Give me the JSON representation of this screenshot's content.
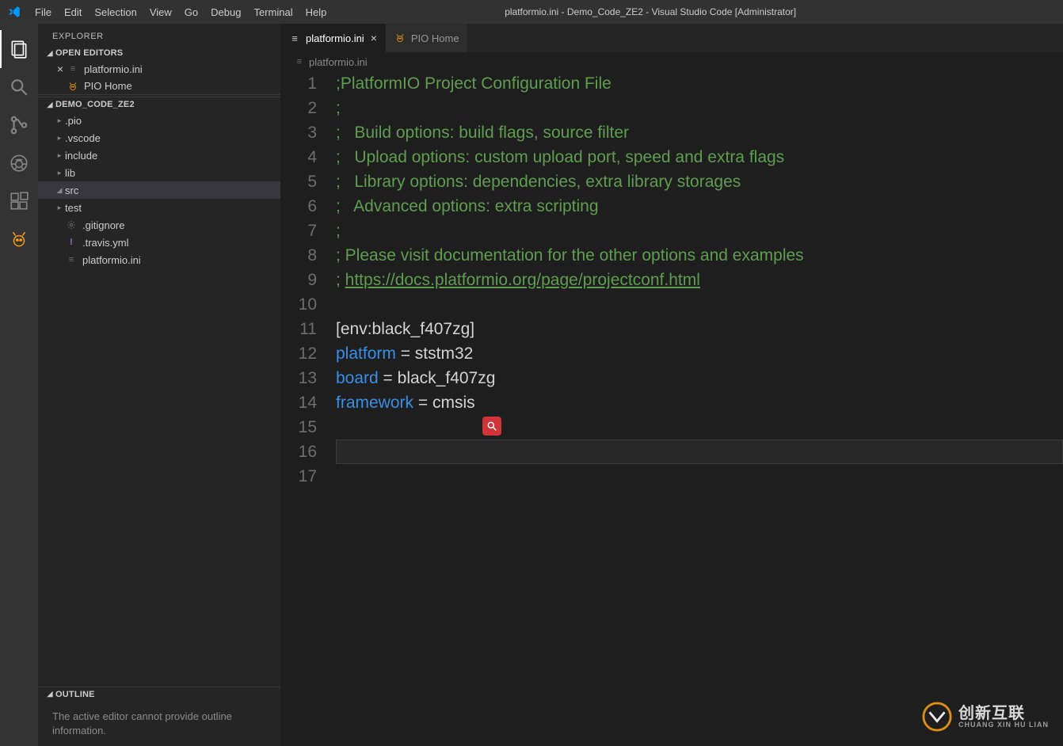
{
  "window": {
    "title": "platformio.ini - Demo_Code_ZE2 - Visual Studio Code [Administrator]"
  },
  "menubar": [
    "File",
    "Edit",
    "Selection",
    "View",
    "Go",
    "Debug",
    "Terminal",
    "Help"
  ],
  "sidebar": {
    "header": "EXPLORER",
    "open_editors_label": "OPEN EDITORS",
    "open_editors": [
      {
        "name": "platformio.ini",
        "icon": "settings"
      },
      {
        "name": "PIO Home",
        "icon": "pio"
      }
    ],
    "workspace_label": "DEMO_CODE_ZE2",
    "tree": [
      {
        "kind": "folder",
        "name": ".pio"
      },
      {
        "kind": "folder",
        "name": ".vscode"
      },
      {
        "kind": "folder",
        "name": "include"
      },
      {
        "kind": "folder",
        "name": "lib"
      },
      {
        "kind": "folder",
        "name": "src",
        "expanded": true,
        "selected": true
      },
      {
        "kind": "folder",
        "name": "test"
      },
      {
        "kind": "file",
        "name": ".gitignore",
        "icon": "gear"
      },
      {
        "kind": "file",
        "name": ".travis.yml",
        "icon": "bang"
      },
      {
        "kind": "file",
        "name": "platformio.ini",
        "icon": "settings"
      }
    ],
    "outline_label": "OUTLINE",
    "outline_msg": "The active editor cannot provide outline information."
  },
  "tabs": [
    {
      "name": "platformio.ini",
      "icon": "settings",
      "active": true,
      "closeable": true
    },
    {
      "name": "PIO Home",
      "icon": "pio",
      "active": false,
      "closeable": false
    }
  ],
  "breadcrumb": {
    "label": "platformio.ini",
    "icon": "settings"
  },
  "editor": {
    "lines": [
      {
        "n": 1,
        "t": "comment",
        "text": ";PlatformIO Project Configuration File"
      },
      {
        "n": 2,
        "t": "comment",
        "text": ";"
      },
      {
        "n": 3,
        "t": "comment",
        "text": ";   Build options: build flags, source filter"
      },
      {
        "n": 4,
        "t": "comment",
        "text": ";   Upload options: custom upload port, speed and extra flags"
      },
      {
        "n": 5,
        "t": "comment",
        "text": ";   Library options: dependencies, extra library storages"
      },
      {
        "n": 6,
        "t": "comment",
        "text": ";   Advanced options: extra scripting"
      },
      {
        "n": 7,
        "t": "comment",
        "text": ";"
      },
      {
        "n": 8,
        "t": "comment",
        "text": "; Please visit documentation for the other options and examples"
      },
      {
        "n": 9,
        "t": "commentlink",
        "pre": "; ",
        "link": "https://docs.platformio.org/page/projectconf.html"
      },
      {
        "n": 10,
        "t": "blank"
      },
      {
        "n": 11,
        "t": "section",
        "text": "[env:black_f407zg]"
      },
      {
        "n": 12,
        "t": "kv",
        "key": "platform",
        "val": "ststm32"
      },
      {
        "n": 13,
        "t": "kv",
        "key": "board",
        "val": "black_f407zg"
      },
      {
        "n": 14,
        "t": "kv",
        "key": "framework",
        "val": "cmsis"
      },
      {
        "n": 15,
        "t": "blank",
        "badge": true
      },
      {
        "n": 16,
        "t": "blank",
        "cursor": true
      },
      {
        "n": 17,
        "t": "blank"
      }
    ]
  },
  "watermark": {
    "top": "创新互联",
    "sub": "CHUANG XIN HU LIAN"
  }
}
